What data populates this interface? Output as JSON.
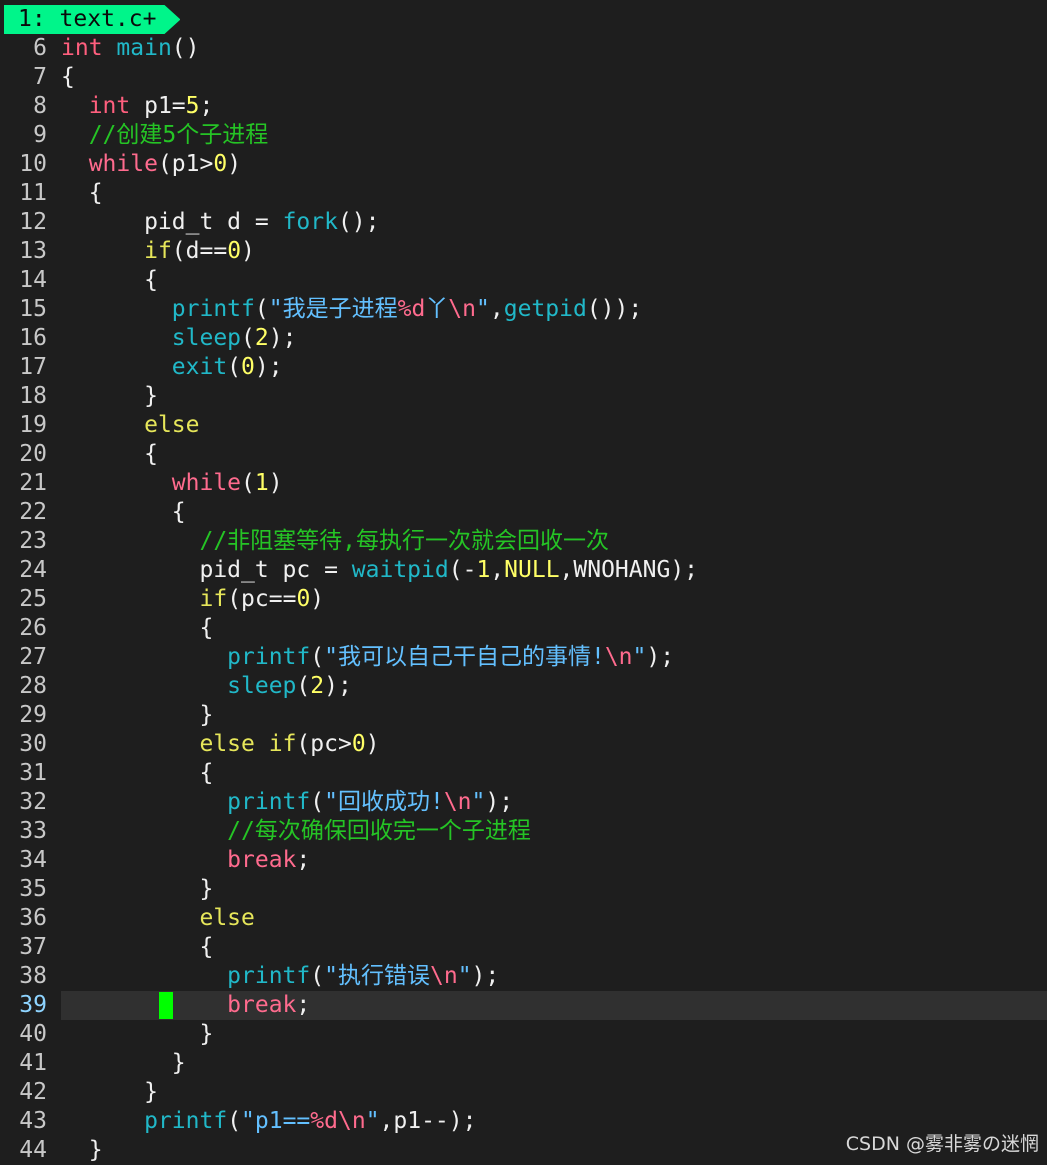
{
  "tab": {
    "label": "1: text.c+"
  },
  "cursor_line": 39,
  "watermark": "CSDN @雾非雾の迷惘",
  "lines": [
    {
      "n": "6",
      "tokens": [
        [
          "ty",
          "int"
        ],
        [
          "p",
          " "
        ],
        [
          "fn",
          "main"
        ],
        [
          "p",
          "()"
        ]
      ]
    },
    {
      "n": "7",
      "tokens": [
        [
          "p",
          "{"
        ]
      ]
    },
    {
      "n": "8",
      "tokens": [
        [
          "p",
          "  "
        ],
        [
          "ty",
          "int"
        ],
        [
          "p",
          " p1="
        ],
        [
          "num",
          "5"
        ],
        [
          "p",
          ";"
        ]
      ]
    },
    {
      "n": "9",
      "tokens": [
        [
          "p",
          "  "
        ],
        [
          "cmt",
          "//创建5个子进程"
        ]
      ]
    },
    {
      "n": "10",
      "tokens": [
        [
          "p",
          "  "
        ],
        [
          "kw",
          "while"
        ],
        [
          "p",
          "(p1>"
        ],
        [
          "num",
          "0"
        ],
        [
          "p",
          ")"
        ]
      ]
    },
    {
      "n": "11",
      "tokens": [
        [
          "p",
          "  {"
        ]
      ]
    },
    {
      "n": "12",
      "tokens": [
        [
          "p",
          "      pid_t d = "
        ],
        [
          "fn",
          "fork"
        ],
        [
          "p",
          "();"
        ]
      ]
    },
    {
      "n": "13",
      "tokens": [
        [
          "p",
          "      "
        ],
        [
          "ctl",
          "if"
        ],
        [
          "p",
          "(d=="
        ],
        [
          "num",
          "0"
        ],
        [
          "p",
          ")"
        ]
      ]
    },
    {
      "n": "14",
      "tokens": [
        [
          "p",
          "      {"
        ]
      ]
    },
    {
      "n": "15",
      "tokens": [
        [
          "p",
          "        "
        ],
        [
          "fn",
          "printf"
        ],
        [
          "p",
          "("
        ],
        [
          "str",
          "\"我是子进程"
        ],
        [
          "esc",
          "%d"
        ],
        [
          "str",
          "丫"
        ],
        [
          "esc",
          "\\n"
        ],
        [
          "str",
          "\""
        ],
        [
          "p",
          ","
        ],
        [
          "fn",
          "getpid"
        ],
        [
          "p",
          "());"
        ]
      ]
    },
    {
      "n": "16",
      "tokens": [
        [
          "p",
          "        "
        ],
        [
          "fn",
          "sleep"
        ],
        [
          "p",
          "("
        ],
        [
          "num",
          "2"
        ],
        [
          "p",
          ");"
        ]
      ]
    },
    {
      "n": "17",
      "tokens": [
        [
          "p",
          "        "
        ],
        [
          "fn",
          "exit"
        ],
        [
          "p",
          "("
        ],
        [
          "num",
          "0"
        ],
        [
          "p",
          ");"
        ]
      ]
    },
    {
      "n": "18",
      "tokens": [
        [
          "p",
          "      }"
        ]
      ]
    },
    {
      "n": "19",
      "tokens": [
        [
          "p",
          "      "
        ],
        [
          "ctl",
          "else"
        ]
      ]
    },
    {
      "n": "20",
      "tokens": [
        [
          "p",
          "      {"
        ]
      ]
    },
    {
      "n": "21",
      "tokens": [
        [
          "p",
          "        "
        ],
        [
          "kw",
          "while"
        ],
        [
          "p",
          "("
        ],
        [
          "num",
          "1"
        ],
        [
          "p",
          ")"
        ]
      ]
    },
    {
      "n": "22",
      "tokens": [
        [
          "p",
          "        {"
        ]
      ]
    },
    {
      "n": "23",
      "tokens": [
        [
          "p",
          "          "
        ],
        [
          "cmt",
          "//非阻塞等待,每执行一次就会回收一次"
        ]
      ]
    },
    {
      "n": "24",
      "tokens": [
        [
          "p",
          "          pid_t pc = "
        ],
        [
          "fn",
          "waitpid"
        ],
        [
          "p",
          "(-"
        ],
        [
          "num",
          "1"
        ],
        [
          "p",
          ","
        ],
        [
          "num",
          "NULL"
        ],
        [
          "p",
          ",WNOHANG);"
        ]
      ]
    },
    {
      "n": "25",
      "tokens": [
        [
          "p",
          "          "
        ],
        [
          "ctl",
          "if"
        ],
        [
          "p",
          "(pc=="
        ],
        [
          "num",
          "0"
        ],
        [
          "p",
          ")"
        ]
      ]
    },
    {
      "n": "26",
      "tokens": [
        [
          "p",
          "          {"
        ]
      ]
    },
    {
      "n": "27",
      "tokens": [
        [
          "p",
          "            "
        ],
        [
          "fn",
          "printf"
        ],
        [
          "p",
          "("
        ],
        [
          "str",
          "\"我可以自己干自己的事情!"
        ],
        [
          "esc",
          "\\n"
        ],
        [
          "str",
          "\""
        ],
        [
          "p",
          ");"
        ]
      ]
    },
    {
      "n": "28",
      "tokens": [
        [
          "p",
          "            "
        ],
        [
          "fn",
          "sleep"
        ],
        [
          "p",
          "("
        ],
        [
          "num",
          "2"
        ],
        [
          "p",
          ");"
        ]
      ]
    },
    {
      "n": "29",
      "tokens": [
        [
          "p",
          "          }"
        ]
      ]
    },
    {
      "n": "30",
      "tokens": [
        [
          "p",
          "          "
        ],
        [
          "ctl",
          "else if"
        ],
        [
          "p",
          "(pc>"
        ],
        [
          "num",
          "0"
        ],
        [
          "p",
          ")"
        ]
      ]
    },
    {
      "n": "31",
      "tokens": [
        [
          "p",
          "          {"
        ]
      ]
    },
    {
      "n": "32",
      "tokens": [
        [
          "p",
          "            "
        ],
        [
          "fn",
          "printf"
        ],
        [
          "p",
          "("
        ],
        [
          "str",
          "\"回收成功!"
        ],
        [
          "esc",
          "\\n"
        ],
        [
          "str",
          "\""
        ],
        [
          "p",
          ");"
        ]
      ]
    },
    {
      "n": "33",
      "tokens": [
        [
          "p",
          "            "
        ],
        [
          "cmt",
          "//每次确保回收完一个子进程"
        ]
      ]
    },
    {
      "n": "34",
      "tokens": [
        [
          "p",
          "            "
        ],
        [
          "kw",
          "break"
        ],
        [
          "p",
          ";"
        ]
      ]
    },
    {
      "n": "35",
      "tokens": [
        [
          "p",
          "          }"
        ]
      ]
    },
    {
      "n": "36",
      "tokens": [
        [
          "p",
          "          "
        ],
        [
          "ctl",
          "else"
        ]
      ]
    },
    {
      "n": "37",
      "tokens": [
        [
          "p",
          "          {"
        ]
      ]
    },
    {
      "n": "38",
      "tokens": [
        [
          "p",
          "            "
        ],
        [
          "fn",
          "printf"
        ],
        [
          "p",
          "("
        ],
        [
          "str",
          "\"执行错误"
        ],
        [
          "esc",
          "\\n"
        ],
        [
          "str",
          "\""
        ],
        [
          "p",
          ");"
        ]
      ]
    },
    {
      "n": "39",
      "tokens": [
        [
          "p",
          "            "
        ],
        [
          "kw",
          "break"
        ],
        [
          "p",
          ";"
        ]
      ]
    },
    {
      "n": "40",
      "tokens": [
        [
          "p",
          "          }"
        ]
      ]
    },
    {
      "n": "41",
      "tokens": [
        [
          "p",
          "        }"
        ]
      ]
    },
    {
      "n": "42",
      "tokens": [
        [
          "p",
          "      }"
        ]
      ]
    },
    {
      "n": "43",
      "tokens": [
        [
          "p",
          "      "
        ],
        [
          "fn",
          "printf"
        ],
        [
          "p",
          "("
        ],
        [
          "str",
          "\"p1=="
        ],
        [
          "esc",
          "%d\\n"
        ],
        [
          "str",
          "\""
        ],
        [
          "p",
          ",p1--);"
        ]
      ]
    },
    {
      "n": "44",
      "tokens": [
        [
          "p",
          "  }"
        ]
      ]
    }
  ]
}
